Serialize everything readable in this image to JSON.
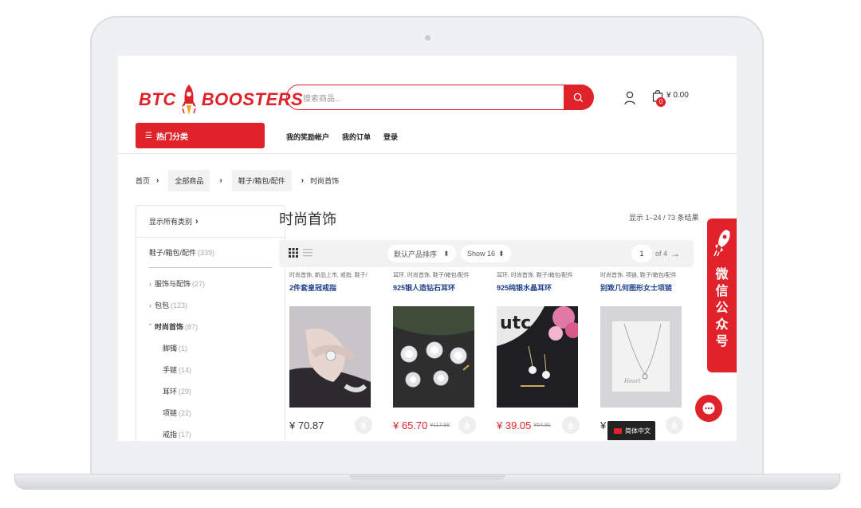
{
  "header": {
    "logo_left": "BTC",
    "logo_right": "BOOSTERS",
    "search_placeholder": "搜索商品...",
    "cart_count": "0",
    "cart_total": "¥ 0.00",
    "category_button": "热门分类",
    "nav": [
      "我的奖励帐户",
      "我的订单",
      "登录"
    ]
  },
  "breadcrumb": [
    "首页",
    "全部商品",
    "鞋子/箱包/配件",
    "时尚首饰"
  ],
  "sidebar": {
    "show_all": "显示所有类别",
    "parent": {
      "label": "鞋子/箱包/配件",
      "count": "(339)"
    },
    "items": [
      {
        "label": "服饰与配饰",
        "count": "(27)",
        "arrow": "›",
        "level": "top"
      },
      {
        "label": "包包",
        "count": "(123)",
        "arrow": "›",
        "level": "top"
      },
      {
        "label": "时尚首饰",
        "count": "(87)",
        "arrow": "ˆ",
        "level": "top",
        "active": true
      },
      {
        "label": "脚镯",
        "count": "(1)",
        "arrow": "",
        "level": "sub"
      },
      {
        "label": "手链",
        "count": "(14)",
        "arrow": "",
        "level": "sub"
      },
      {
        "label": "耳环",
        "count": "(29)",
        "arrow": "",
        "level": "sub"
      },
      {
        "label": "项链",
        "count": "(22)",
        "arrow": "",
        "level": "sub"
      },
      {
        "label": "戒指",
        "count": "(17)",
        "arrow": "",
        "level": "sub"
      }
    ]
  },
  "main": {
    "title": "时尚首饰",
    "result_count": "显示 1–24 / 73 条结果",
    "sort_label": "默认产品排序",
    "show_label": "Show 16",
    "page_current": "1",
    "page_of": "of 4",
    "products": [
      {
        "cats": "时尚首饰, 新品上市, 戒指, 鞋子/",
        "name": "2件套皇冠戒指",
        "price": "¥ 70.87",
        "old_price": "",
        "sale": false
      },
      {
        "cats": "耳环, 时尚首饰, 鞋子/箱包/配件",
        "name": "925银人造钻石耳环",
        "price": "¥ 65.70",
        "old_price": "¥117.88",
        "sale": true
      },
      {
        "cats": "耳环, 时尚首饰, 鞋子/箱包/配件",
        "name": "925纯银水晶耳环",
        "price": "¥ 39.05",
        "old_price": "¥54.91",
        "sale": true
      },
      {
        "cats": "时尚首饰, 项链, 鞋子/箱包/配件",
        "name": "别致几何图形女士项链",
        "price": "¥",
        "old_price": "",
        "sale": false
      }
    ]
  },
  "wechat_tab": "微信公众号",
  "language": "简体中文",
  "colors": {
    "brand": "#e0232a",
    "link": "#1e3f8a"
  }
}
